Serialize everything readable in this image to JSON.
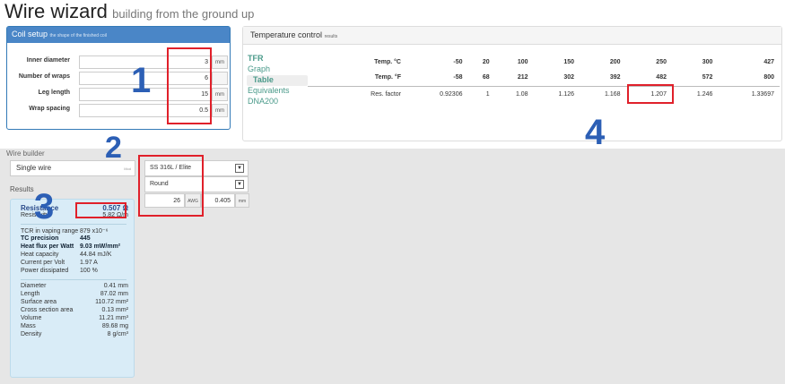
{
  "header": {
    "title": "Wire wizard",
    "subtitle": "building from the ground up"
  },
  "coil_setup": {
    "title": "Coil setup",
    "subtitle": "the shape of the finished coil",
    "fields": [
      {
        "label": "Inner diameter",
        "value": "3",
        "unit": "mm"
      },
      {
        "label": "Number of wraps",
        "value": "6",
        "unit": ""
      },
      {
        "label": "Leg length",
        "value": "15",
        "unit": "mm"
      },
      {
        "label": "Wrap spacing",
        "value": "0.5",
        "unit": "mm"
      }
    ]
  },
  "temperature_control": {
    "title": "Temperature control",
    "subtitle": "results",
    "menu": [
      "TFR",
      "Graph",
      "Table",
      "Equivalents",
      "DNA200"
    ],
    "active_menu": "Table",
    "rows": [
      {
        "label": "Temp. °C",
        "values": [
          "-50",
          "20",
          "100",
          "150",
          "200",
          "250",
          "300",
          "427"
        ]
      },
      {
        "label": "Temp. °F",
        "values": [
          "-58",
          "68",
          "212",
          "302",
          "392",
          "482",
          "572",
          "800"
        ]
      },
      {
        "label": "Res. factor",
        "values": [
          "0.92306",
          "1",
          "1.08",
          "1.126",
          "1.168",
          "1.207",
          "1.246",
          "1.33697"
        ]
      }
    ]
  },
  "wire_builder": {
    "title": "Wire builder",
    "wire_type": "Single wire",
    "wire_type_tag": "Mod",
    "material": "SS 316L / Elite",
    "shape": "Round",
    "gauge": "26",
    "gauge_unit": "AWG",
    "diameter": "0.405",
    "diameter_unit": "mm"
  },
  "results": {
    "title": "Results",
    "resistance": {
      "label": "Resistance",
      "value": "0.507 Ω"
    },
    "resistivity": {
      "label": "Resistivity",
      "value": "5.82 Ω/m"
    },
    "tcr": {
      "label": "TCR in vaping range",
      "value": "879 x10⁻⁶"
    },
    "tc_precision": {
      "label": "TC precision",
      "value": "445"
    },
    "heat_flux": {
      "label": "Heat flux per Watt",
      "value": "9.03 mW/mm²"
    },
    "heat_capacity": {
      "label": "Heat capacity",
      "value": "44.84 mJ/K"
    },
    "current_per_volt": {
      "label": "Current per Volt",
      "value": "1.97 A"
    },
    "power_dissipated": {
      "label": "Power dissipated",
      "value": "100 %"
    },
    "diameter": {
      "label": "Diameter",
      "value": "0.41 mm"
    },
    "length": {
      "label": "Length",
      "value": "87.02 mm"
    },
    "surface_area": {
      "label": "Surface area",
      "value": "110.72 mm²"
    },
    "cross_section": {
      "label": "Cross section area",
      "value": "0.13 mm²"
    },
    "volume": {
      "label": "Volume",
      "value": "11.21 mm³"
    },
    "mass": {
      "label": "Mass",
      "value": "89.68 mg"
    },
    "density": {
      "label": "Density",
      "value": "8 g/cm³"
    }
  },
  "annotations": [
    "1",
    "2",
    "3",
    "4"
  ],
  "colors": {
    "highlight": "#e0202a",
    "annotation": "#2c5fb5",
    "panel_blue": "#4a86c7",
    "link": "#4a9a8a",
    "results_bg": "#d9ecf7"
  }
}
